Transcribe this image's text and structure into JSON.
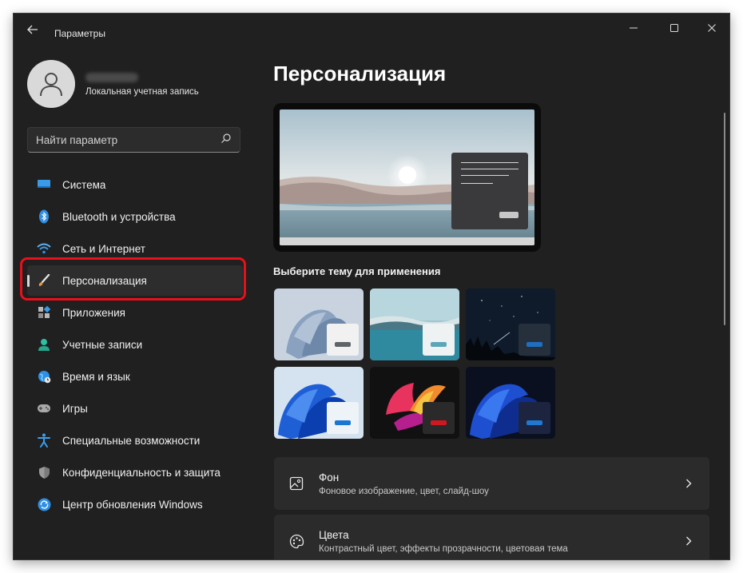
{
  "window": {
    "title": "Параметры",
    "controls": [
      "minimize-icon",
      "maximize-icon",
      "close-icon"
    ]
  },
  "account": {
    "type": "Локальная учетная запись"
  },
  "search": {
    "placeholder": "Найти параметр"
  },
  "sidebar": {
    "items": [
      {
        "label": "Система",
        "icon": "monitor-icon"
      },
      {
        "label": "Bluetooth и устройства",
        "icon": "bluetooth-icon"
      },
      {
        "label": "Сеть и Интернет",
        "icon": "wifi-icon"
      },
      {
        "label": "Персонализация",
        "icon": "brush-icon",
        "active": true
      },
      {
        "label": "Приложения",
        "icon": "apps-icon"
      },
      {
        "label": "Учетные записи",
        "icon": "person-icon"
      },
      {
        "label": "Время и язык",
        "icon": "globe-clock-icon"
      },
      {
        "label": "Игры",
        "icon": "gamepad-icon"
      },
      {
        "label": "Специальные возможности",
        "icon": "accessibility-icon"
      },
      {
        "label": "Конфиденциальность и защита",
        "icon": "shield-icon"
      },
      {
        "label": "Центр обновления Windows",
        "icon": "update-icon"
      }
    ]
  },
  "main": {
    "title": "Персонализация",
    "themes_label": "Выберите тему для применения",
    "themes": [
      {
        "style": "light-bloom",
        "accent": "#5f6469"
      },
      {
        "style": "glow-lake",
        "accent": "#5ba6b9"
      },
      {
        "style": "night-sky",
        "accent": "#1f6fc0"
      },
      {
        "style": "blue-bloom",
        "accent": "#1976d2"
      },
      {
        "style": "captured-motion",
        "accent": "#d01822"
      },
      {
        "style": "dark-bloom",
        "accent": "#1f78d1"
      }
    ],
    "settings": [
      {
        "title": "Фон",
        "subtitle": "Фоновое изображение, цвет, слайд-шоу",
        "icon": "image-icon"
      },
      {
        "title": "Цвета",
        "subtitle": "Контрастный цвет, эффекты прозрачности, цветовая тема",
        "icon": "palette-icon"
      }
    ]
  },
  "colors": {
    "window_bg": "#202020",
    "card_bg": "#2b2b2b",
    "highlight": "#e8101a"
  }
}
